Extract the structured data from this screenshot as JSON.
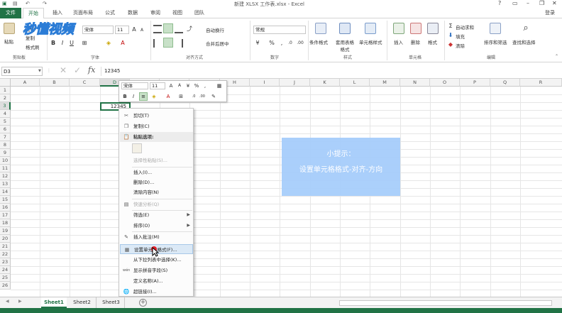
{
  "window": {
    "title": "新建 XLSX 工作表.xlsx - Excel",
    "controls": [
      "?",
      "▭",
      "–",
      "❐",
      "✕"
    ],
    "user": "登录"
  },
  "tabs": [
    "文件",
    "开始",
    "插入",
    "页面布局",
    "公式",
    "数据",
    "审阅",
    "视图",
    "团队"
  ],
  "ribbon": {
    "clipboard": {
      "paste": "粘贴",
      "cut": "剪切",
      "copy": "复制",
      "format_painter": "格式刷",
      "label": "剪贴板"
    },
    "font": {
      "name": "宋体",
      "size": "11",
      "bold": "B",
      "italic": "I",
      "underline": "U",
      "label": "字体"
    },
    "alignment": {
      "wrap": "自动换行",
      "merge": "合并后居中",
      "label": "对齐方式"
    },
    "number": {
      "format": "常规",
      "percent": "%",
      "comma": ",",
      "label": "数字"
    },
    "styles": {
      "conditional": "条件格式",
      "table": "套用表格格式",
      "cell": "单元格样式",
      "label": "样式"
    },
    "cells": {
      "insert": "插入",
      "delete": "删除",
      "format": "格式",
      "label": "单元格"
    },
    "editing": {
      "autosum": "自动求和",
      "fill": "填充",
      "clear": "清除",
      "sort": "排序和筛选",
      "find": "查找和选择",
      "label": "编辑"
    }
  },
  "formula_bar": {
    "name_box": "D3",
    "fx": "fx",
    "value": "12345"
  },
  "columns": [
    "A",
    "B",
    "C",
    "D",
    "E",
    "F",
    "G",
    "H",
    "I",
    "J",
    "K",
    "L",
    "M",
    "N",
    "O",
    "P",
    "Q",
    "R"
  ],
  "rows": [
    "1",
    "2",
    "3",
    "4",
    "5",
    "6",
    "7",
    "8",
    "9",
    "10",
    "11",
    "12",
    "13",
    "14",
    "15",
    "16",
    "17",
    "18",
    "19",
    "20",
    "21",
    "22",
    "23",
    "24",
    "25",
    "26"
  ],
  "cell_d3": "12345",
  "mini_toolbar": {
    "font": "宋体",
    "size": "11",
    "percent": "%",
    "comma": ",",
    "bold": "B",
    "italic": "I",
    "font_color": "A"
  },
  "context_menu": {
    "cut": "剪切(T)",
    "copy": "复制(C)",
    "paste_options": "粘贴选项:",
    "paste_special": "选择性粘贴(S)...",
    "insert": "插入(I)...",
    "delete": "删除(D)...",
    "clear": "清除内容(N)",
    "quick_analysis": "快速分析(Q)",
    "filter": "筛选(E)",
    "sort": "排序(O)",
    "insert_comment": "插入批注(M)",
    "format_cells": "设置单元格格式(F)...",
    "dropdown": "从下拉列表中选择(K)...",
    "phonetic": "显示拼音字段(S)",
    "define_name": "定义名称(A)...",
    "hyperlink": "超链接(I)..."
  },
  "tip": {
    "title": "小提示：",
    "body": "设置单元格格式-对齐-方向"
  },
  "sheets": [
    "Sheet1",
    "Sheet2",
    "Sheet3"
  ],
  "watermark": "秒懂视频",
  "colors": {
    "excel_green": "#217346",
    "tip_blue": "#a6cdfb",
    "highlight": "#dbe9f6"
  }
}
